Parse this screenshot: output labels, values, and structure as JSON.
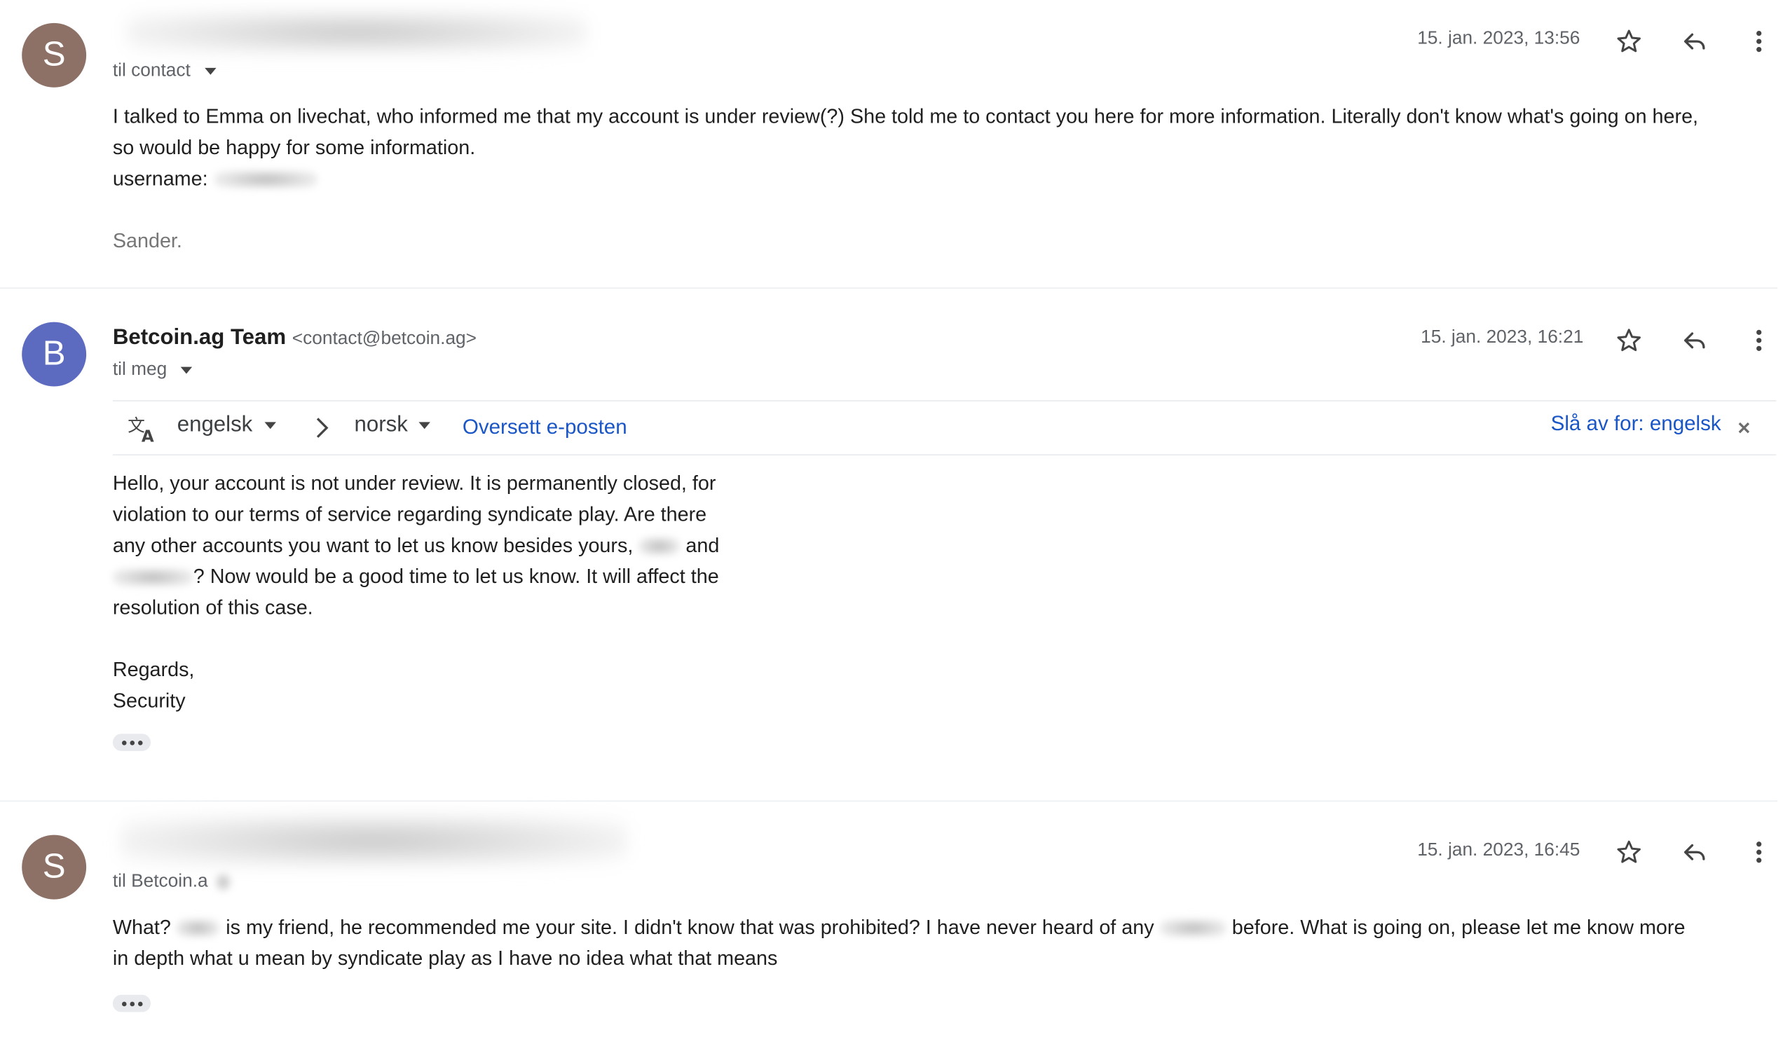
{
  "messages": [
    {
      "avatar_letter": "S",
      "avatar_color": "#8d7166",
      "recipient": "til contact",
      "date": "15. jan. 2023, 13:56",
      "body": [
        "I talked to Emma on livechat, who informed me that my account is under review(?) She told me to contact you here for more information. Literally don't know what's going on here,",
        "so would be happy for some information.",
        "username:"
      ],
      "signature": "Sander."
    },
    {
      "avatar_letter": "B",
      "avatar_color": "#5c6bc0",
      "sender_name": "Betcoin.ag Team",
      "sender_email": "<contact@betcoin.ag>",
      "recipient": "til meg",
      "date": "15. jan. 2023, 16:21",
      "translate": {
        "from": "engelsk",
        "to": "norsk",
        "translate_link": "Oversett e-posten",
        "turn_off": "Slå av for: engelsk"
      },
      "body": [
        "Hello, your account is not under review. It is permanently closed, for",
        "violation to our terms of service regarding syndicate play. Are there",
        "any other accounts you want to let us know besides yours,",
        "and",
        "? Now would be a good time to let us know. It will affect the",
        "resolution of this case."
      ],
      "closing": [
        "Regards,",
        "Security"
      ]
    },
    {
      "avatar_letter": "S",
      "avatar_color": "#8d7166",
      "recipient": "til Betcoin.a",
      "date": "15. jan. 2023, 16:45",
      "body_parts": [
        "What?",
        "is my friend, he recommended me your site. I didn't know that was prohibited? I have never heard of any",
        "before. What is going on, please let me know more",
        "in depth what u mean by syndicate play as I have no idea what that means"
      ]
    }
  ],
  "icons": {
    "star": "star-icon",
    "reply": "reply-icon",
    "more": "more-vert-icon",
    "translate": "translate-icon",
    "close": "close-icon"
  }
}
